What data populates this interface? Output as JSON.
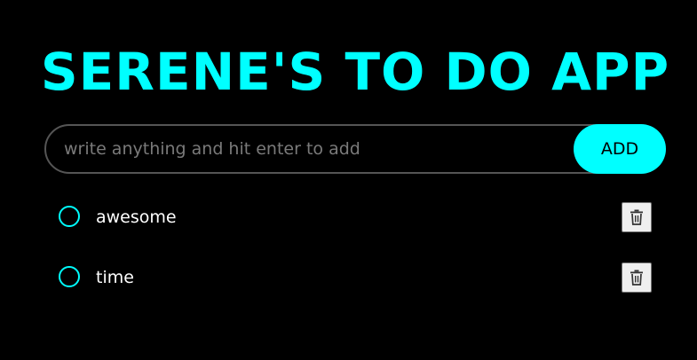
{
  "app": {
    "title": "SERENE'S TO DO APP"
  },
  "input": {
    "placeholder": "write anything and hit enter to add",
    "value": "",
    "add_label": "ADD"
  },
  "todos": [
    {
      "text": "awesome",
      "completed": false,
      "delete_icon": "trash-icon"
    },
    {
      "text": "time",
      "completed": false,
      "delete_icon": "trash-icon"
    }
  ],
  "colors": {
    "accent": "#00FFFF",
    "background": "#000000",
    "text": "#FFFFFF",
    "placeholder": "#7A7A7A",
    "input_border": "#555555"
  }
}
